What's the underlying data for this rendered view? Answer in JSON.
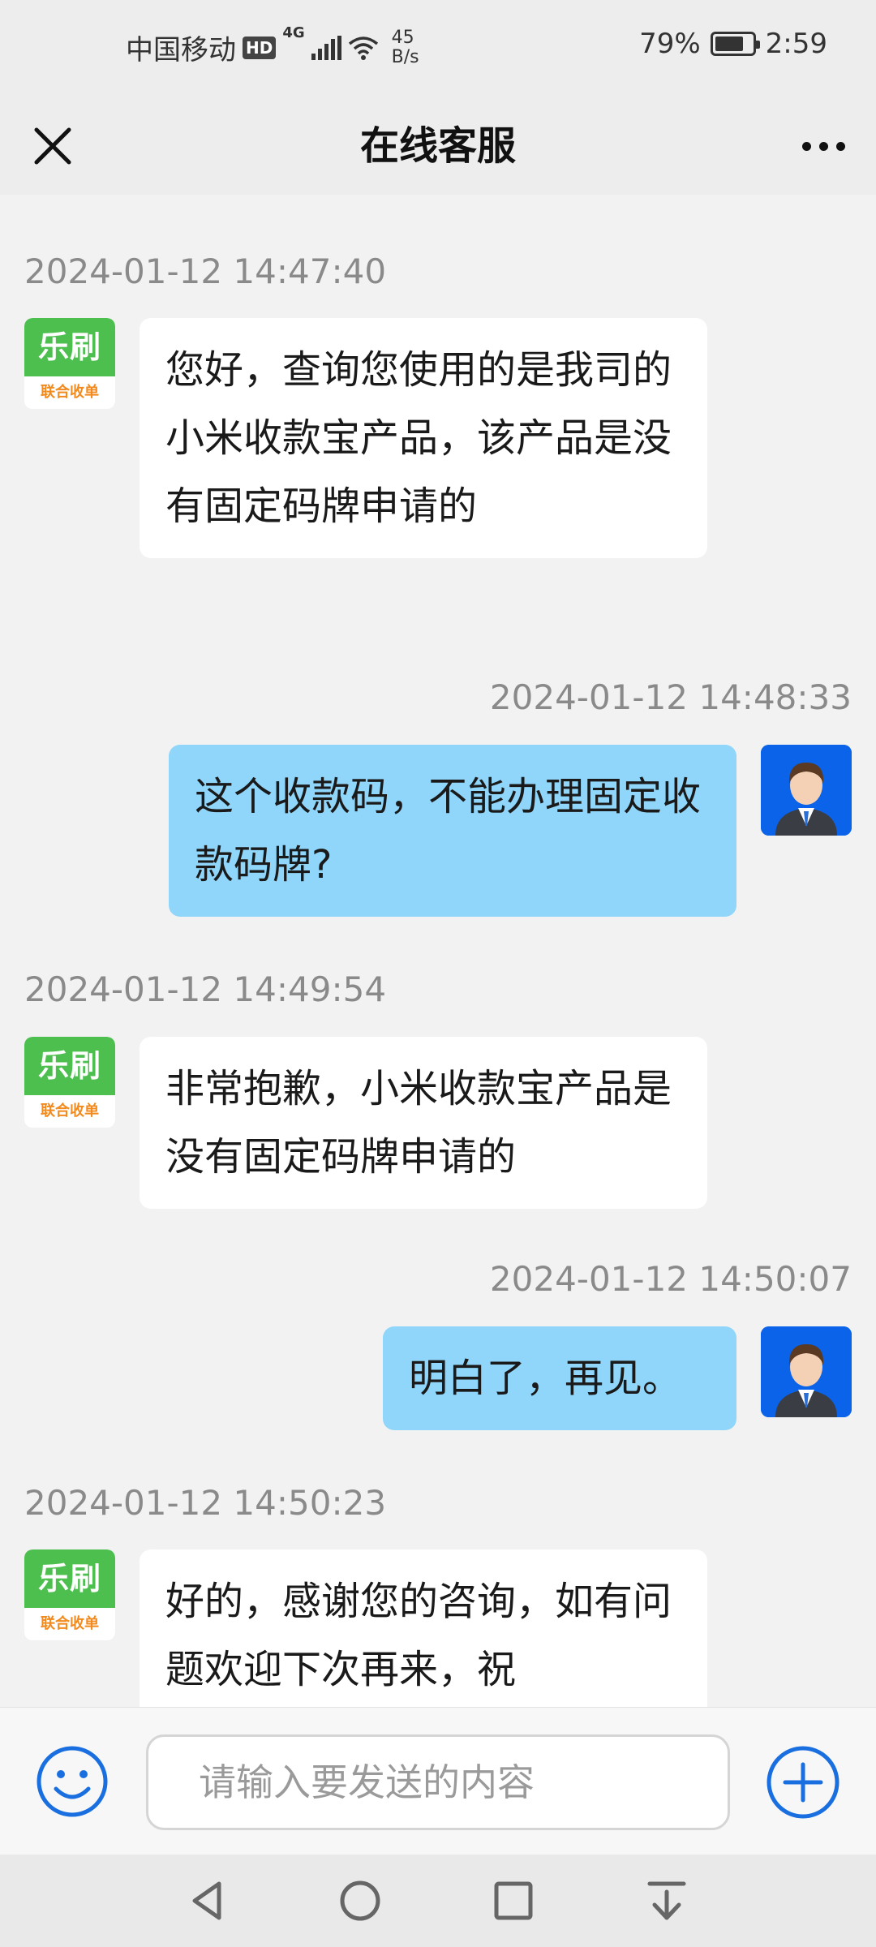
{
  "status_bar": {
    "carrier": "中国移动",
    "hd_badge": "HD",
    "network_type": "4G",
    "speed_value": "45",
    "speed_unit": "B/s",
    "battery_percent": "79%",
    "battery_level": 0.79,
    "time": "2:59"
  },
  "header": {
    "title": "在线客服",
    "close_icon": "close-icon",
    "more_icon": "more-dots-icon"
  },
  "agent_logo": {
    "top_text": "乐刷",
    "bottom_text": "联合收单",
    "colors": {
      "green": "#4cbf4f",
      "orange": "#f28a1e"
    }
  },
  "messages": [
    {
      "sender": "agent",
      "timestamp": "2024-01-12 14:47:40",
      "text": "您好，查询您使用的是我司的小米收款宝产品，该产品是没有固定码牌申请的"
    },
    {
      "sender": "user",
      "timestamp": "2024-01-12 14:48:33",
      "text": "这个收款码，不能办理固定收款码牌?"
    },
    {
      "sender": "agent",
      "timestamp": "2024-01-12 14:49:54",
      "text": "非常抱歉，小米收款宝产品是没有固定码牌申请的"
    },
    {
      "sender": "user",
      "timestamp": "2024-01-12 14:50:07",
      "text": "明白了，再见。"
    },
    {
      "sender": "agent",
      "timestamp": "2024-01-12 14:50:23",
      "text": "好的，感谢您的咨询，如有问题欢迎下次再来，祝"
    }
  ],
  "input_bar": {
    "placeholder": "请输入要发送的内容",
    "emoji_icon": "emoji-icon",
    "plus_icon": "plus-icon"
  },
  "colors": {
    "user_bubble": "#8fd6fa",
    "agent_bubble": "#ffffff",
    "accent_blue": "#1a6fe0",
    "user_avatar_bg": "#0a63e8"
  }
}
